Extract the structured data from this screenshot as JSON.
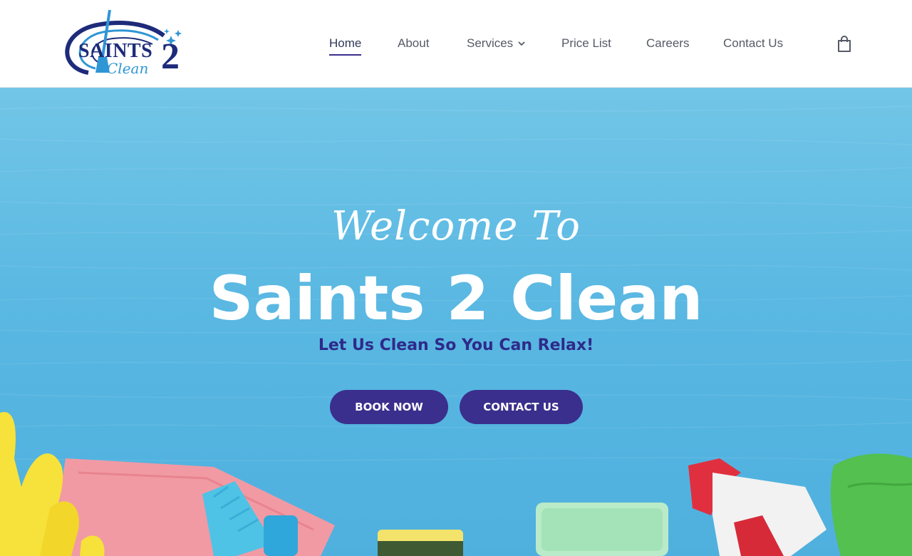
{
  "logo": {
    "word": "SAINTS",
    "number": "2",
    "sub": "Clean"
  },
  "nav": {
    "items": [
      {
        "label": "Home",
        "active": true
      },
      {
        "label": "About"
      },
      {
        "label": "Services",
        "has_dropdown": true
      },
      {
        "label": "Price List"
      },
      {
        "label": "Careers"
      },
      {
        "label": "Contact Us"
      }
    ],
    "cart_icon": "shopping-bag-icon"
  },
  "hero": {
    "welcome": "Welcome To",
    "title": "Saints 2 Clean",
    "tagline": "Let Us Clean So You Can Relax!",
    "buttons": {
      "book": "BOOK NOW",
      "contact": "CONTACT US"
    }
  },
  "colors": {
    "brand_navy": "#1e2b7a",
    "brand_blue": "#2f96d6",
    "button": "#3a2f8c",
    "hero_bg": "#5ab8e2"
  }
}
